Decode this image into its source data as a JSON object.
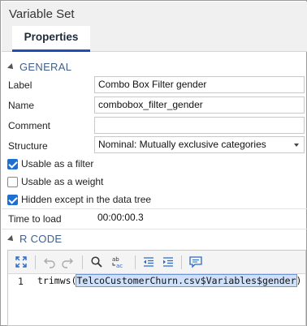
{
  "window": {
    "title": "Variable Set"
  },
  "tabs": [
    {
      "label": "Properties"
    }
  ],
  "general": {
    "header": "GENERAL",
    "label": {
      "caption": "Label",
      "value": "Combo Box Filter gender"
    },
    "name": {
      "caption": "Name",
      "value": "combobox_filter_gender"
    },
    "comment": {
      "caption": "Comment",
      "value": ""
    },
    "structure": {
      "caption": "Structure",
      "value": "Nominal: Mutually exclusive categories"
    },
    "checkboxes": [
      {
        "label": "Usable as a filter",
        "checked": true
      },
      {
        "label": "Usable as a weight",
        "checked": false
      },
      {
        "label": "Hidden except in the data tree",
        "checked": true
      }
    ],
    "time_to_load": {
      "caption": "Time to load",
      "value": "00:00:00.3"
    }
  },
  "rcode": {
    "header": "R CODE",
    "toolbar_icons": [
      "fullscreen-icon",
      "undo-icon",
      "redo-icon",
      "search-icon",
      "replace-icon",
      "outdent-icon",
      "indent-icon",
      "comment-icon"
    ],
    "line_number": "1",
    "code_prefix": "trimws(",
    "code_highlight": "TelcoCustomerChurn.csv$Variables$gender",
    "code_suffix": ") %i"
  },
  "colors": {
    "accent": "#1f4fb5",
    "checkbox": "#1f6fd1",
    "section": "#3f5f8f"
  }
}
